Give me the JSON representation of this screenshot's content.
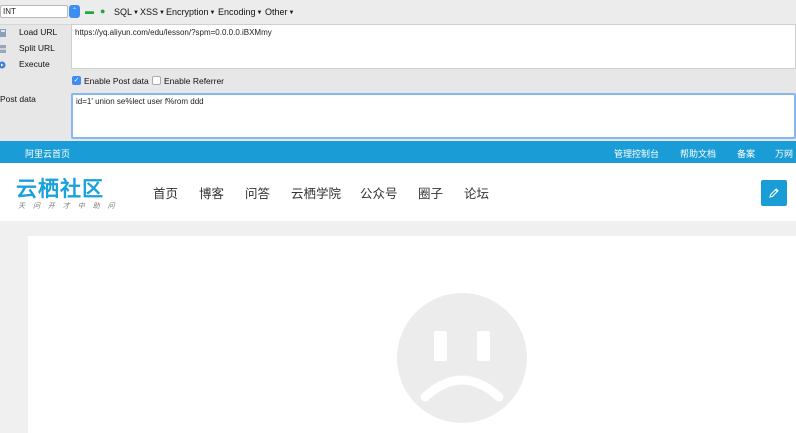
{
  "hackbar": {
    "select_value": "INT",
    "menus": [
      "SQL",
      "XSS",
      "Encryption",
      "Encoding",
      "Other"
    ],
    "actions": [
      {
        "label": "Load URL",
        "icon": "load-url-icon"
      },
      {
        "label": "Split URL",
        "icon": "split-url-icon"
      },
      {
        "label": "Execute",
        "icon": "execute-icon"
      }
    ],
    "url_value": "https://yq.aliyun.com/edu/lesson/?spm=0.0.0.0.iBXMmy",
    "enable_post_label": "Enable Post data",
    "enable_post_checked": true,
    "enable_referrer_label": "Enable Referrer",
    "enable_referrer_checked": false,
    "post_label": "Post data",
    "post_value": "id=1' union se%lect user f%rom ddd"
  },
  "topbar": {
    "home": "阿里云首页",
    "links": [
      "管理控制台",
      "帮助文档",
      "备案",
      "万网"
    ]
  },
  "header": {
    "logo": "云栖社区",
    "logo_sub": "天 问 开 才 中 助 问",
    "nav": [
      "首页",
      "博客",
      "问答",
      "云栖学院",
      "公众号",
      "圈子",
      "论坛"
    ],
    "edit_icon": "pencil-icon"
  },
  "content": {
    "icon": "sad-face-icon"
  },
  "colors": {
    "accent": "#1a9dd6",
    "logo": "#1aa1dc",
    "hackbar_bg": "#e7e7e7"
  }
}
